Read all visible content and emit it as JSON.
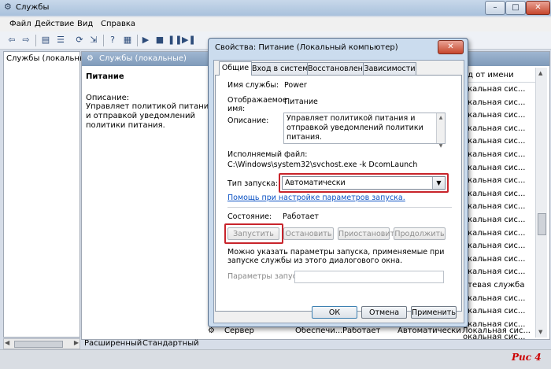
{
  "window": {
    "title": "Службы",
    "min_glyph": "–",
    "max_glyph": "□",
    "close_glyph": "✕"
  },
  "menu": [
    "Файл",
    "Действие",
    "Вид",
    "Справка"
  ],
  "tree": {
    "root": "Службы (локальные)"
  },
  "main": {
    "header": "Службы (локальные)",
    "service_name": "Питание",
    "desc_label": "Описание:",
    "desc_text": "Управляет политикой питания и отправкой уведомлений политики питания.",
    "column_header": "од от имени",
    "right_cells": [
      "окальная сис...",
      "окальная сис...",
      "окальная сис...",
      "окальная сис...",
      "окальная сис...",
      "окальная сис...",
      "окальная сис...",
      "окальная сис...",
      "окальная сис...",
      "окальная сис...",
      "окальная сис...",
      "окальная сис...",
      "окальная сис...",
      "окальная сис...",
      "окальная сис...",
      "етевая служба",
      "окальная сис...",
      "окальная сис...",
      "окальная сис...",
      "окальная сис..."
    ],
    "last_row": {
      "name": "Сервер",
      "desc": "Обеспечи...",
      "status": "Работает",
      "startup": "Автоматически",
      "logon": "Локальная сис..."
    }
  },
  "bottom_tabs": [
    "Расширенный",
    "Стандартный"
  ],
  "figure_label": "Рис 4",
  "dialog": {
    "title": "Свойства: Питание (Локальный компьютер)",
    "close_glyph": "✕",
    "tabs": [
      "Общие",
      "Вход в систему",
      "Восстановление",
      "Зависимости"
    ],
    "service_name_label": "Имя службы:",
    "service_name_value": "Power",
    "display_name_label": "Отображаемое имя:",
    "display_name_value": "Питание",
    "description_label": "Описание:",
    "description_value": "Управляет политикой питания и отправкой уведомлений политики питания.",
    "exe_label": "Исполняемый файл:",
    "exe_value": "C:\\Windows\\system32\\svchost.exe -k DcomLaunch",
    "startup_label": "Тип запуска:",
    "startup_value": "Автоматически",
    "help_link": "Помощь при настройке параметров запуска.",
    "status_label": "Состояние:",
    "status_value": "Работает",
    "buttons": {
      "start": "Запустить",
      "stop": "Остановить",
      "pause": "Приостановить",
      "resume": "Продолжить"
    },
    "hint": "Можно указать параметры запуска, применяемые при запуске службы из этого диалогового окна.",
    "params_label": "Параметры запуска:",
    "ok": "ОК",
    "cancel": "Отмена",
    "apply": "Применить"
  }
}
